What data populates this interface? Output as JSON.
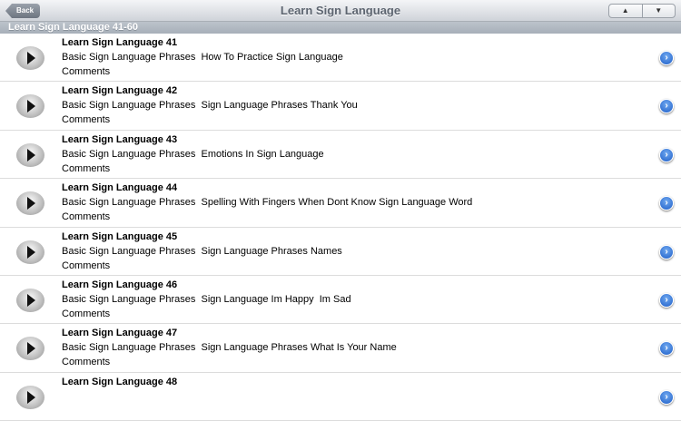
{
  "nav": {
    "back": "Back",
    "title": "Learn Sign Language",
    "up": "▲",
    "down": "▼"
  },
  "section": "Learn Sign Language 41-60",
  "rows": [
    {
      "title": "Learn Sign Language 41",
      "subtitle": "Basic Sign Language Phrases  How To Practice Sign Language",
      "meta": "Comments"
    },
    {
      "title": "Learn Sign Language 42",
      "subtitle": "Basic Sign Language Phrases  Sign Language Phrases Thank You",
      "meta": "Comments"
    },
    {
      "title": "Learn Sign Language 43",
      "subtitle": "Basic Sign Language Phrases  Emotions In Sign Language",
      "meta": "Comments"
    },
    {
      "title": "Learn Sign Language 44",
      "subtitle": "Basic Sign Language Phrases  Spelling With Fingers When Dont Know Sign Language Word",
      "meta": "Comments"
    },
    {
      "title": "Learn Sign Language 45",
      "subtitle": "Basic Sign Language Phrases  Sign Language Phrases Names",
      "meta": "Comments"
    },
    {
      "title": "Learn Sign Language 46",
      "subtitle": "Basic Sign Language Phrases  Sign Language Im Happy  Im Sad",
      "meta": "Comments"
    },
    {
      "title": "Learn Sign Language 47",
      "subtitle": "Basic Sign Language Phrases  Sign Language Phrases What Is Your Name",
      "meta": "Comments"
    },
    {
      "title": "Learn Sign Language 48",
      "subtitle": "",
      "meta": ""
    }
  ]
}
